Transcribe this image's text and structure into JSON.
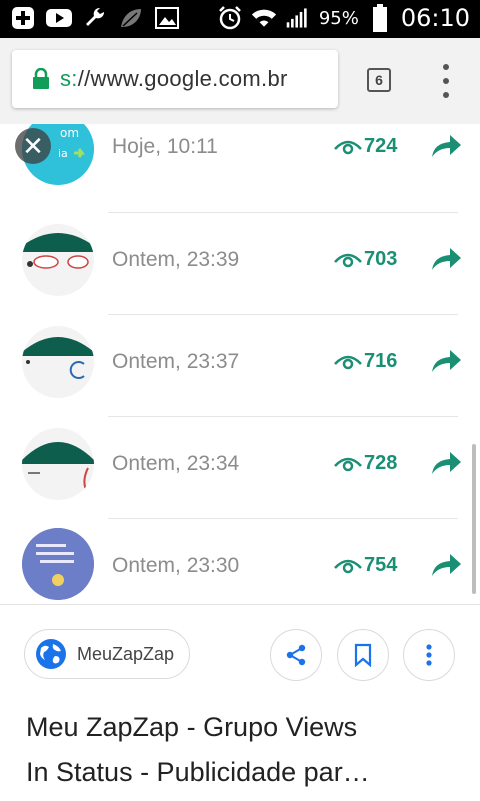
{
  "status_bar": {
    "icons": [
      "add-notification-icon",
      "youtube-icon",
      "wrench-icon",
      "leaf-icon",
      "image-icon",
      "alarm-icon",
      "wifi-icon",
      "signal-icon",
      "battery-icon"
    ],
    "battery": "95%",
    "time": "06:10"
  },
  "browser": {
    "url_scheme": "s:",
    "url_rest": "//www.google.com.br",
    "tab_count": "6"
  },
  "list": [
    {
      "time": "Hoje, 10:11",
      "views": "724"
    },
    {
      "time": "Ontem, 23:39",
      "views": "703"
    },
    {
      "time": "Ontem, 23:37",
      "views": "716"
    },
    {
      "time": "Ontem, 23:34",
      "views": "728"
    },
    {
      "time": "Ontem, 23:30",
      "views": "754"
    }
  ],
  "panel": {
    "source": "MeuZapZap",
    "title": "Meu ZapZap - Grupo Views\nIn Status - Publicidade par…"
  },
  "colors": {
    "accent": "#1b8f74",
    "lock": "#0f9d58",
    "action_blue": "#1a73e8"
  }
}
